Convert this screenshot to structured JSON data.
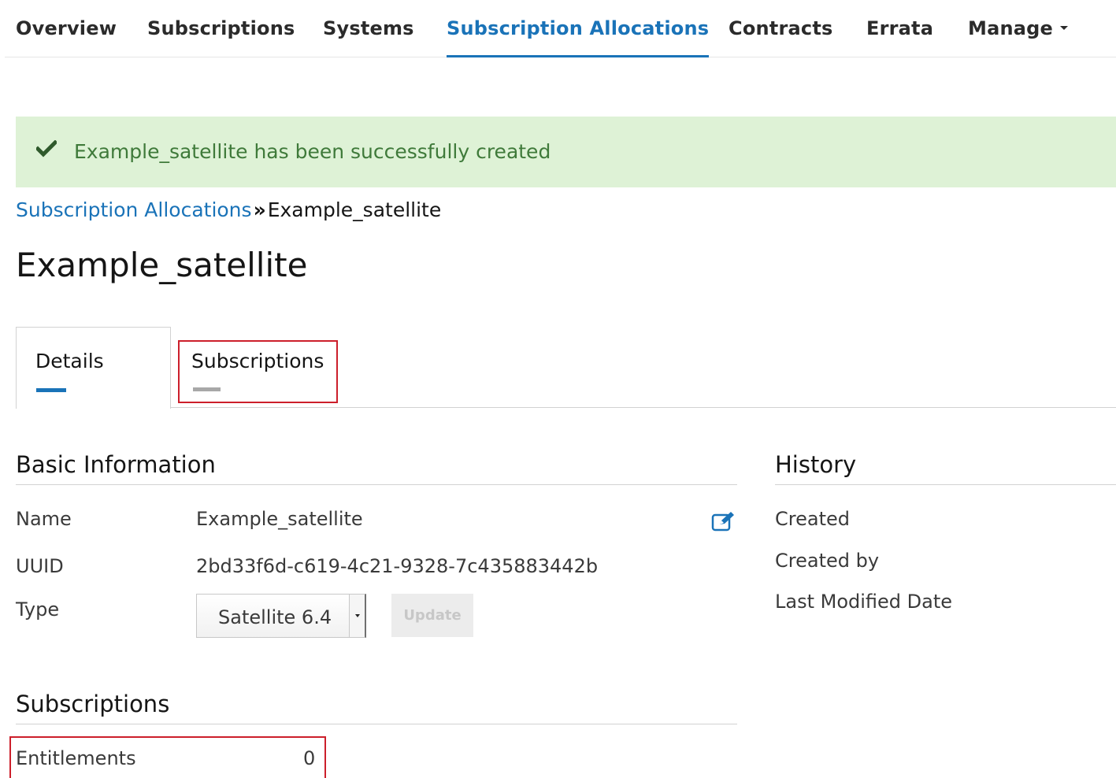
{
  "nav": {
    "items": [
      {
        "label": "Overview"
      },
      {
        "label": "Subscriptions"
      },
      {
        "label": "Systems"
      },
      {
        "label": "Subscription Allocations",
        "active": true
      },
      {
        "label": "Contracts"
      },
      {
        "label": "Errata"
      },
      {
        "label": "Manage"
      }
    ]
  },
  "alert": {
    "message": "Example_satellite has been successfully created",
    "icon": "checkmark-icon",
    "color": "#def2d6"
  },
  "breadcrumb": {
    "parent": "Subscription Allocations",
    "separator": "»",
    "current": "Example_satellite"
  },
  "page": {
    "title": "Example_satellite"
  },
  "tabs": [
    {
      "label": "Details",
      "active": true
    },
    {
      "label": "Subscriptions",
      "active": false
    }
  ],
  "basic_info": {
    "heading": "Basic Information",
    "name_label": "Name",
    "name_value": "Example_satellite",
    "uuid_label": "UUID",
    "uuid_value": "2bd33f6d-c619-4c21-9328-7c435883442b",
    "type_label": "Type",
    "type_value": "Satellite 6.4",
    "update_label": "Update"
  },
  "history": {
    "heading": "History",
    "created_label": "Created",
    "created_by_label": "Created by",
    "last_modified_label": "Last Modified Date"
  },
  "subscriptions": {
    "heading": "Subscriptions",
    "entitlements_label": "Entitlements",
    "entitlements_value": "0"
  },
  "colors": {
    "accent": "#1a73b8",
    "success_bg": "#def2d6",
    "success_text": "#3f7a3a",
    "highlight": "#cc1f2b"
  }
}
